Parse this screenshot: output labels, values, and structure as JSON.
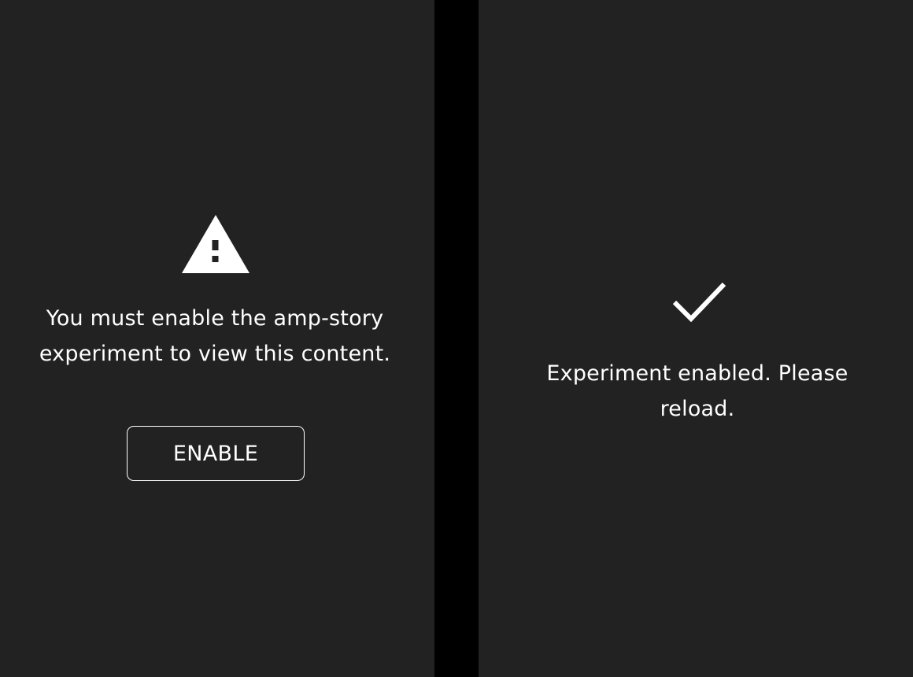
{
  "colors": {
    "page_background": "#000000",
    "panel_background": "#222222",
    "foreground": "#ffffff"
  },
  "left_panel": {
    "icon": "warning-triangle-icon",
    "message": "You must enable the amp-story experiment to view this content.",
    "button_label": "ENABLE"
  },
  "right_panel": {
    "icon": "checkmark-icon",
    "message": "Experiment enabled. Please reload."
  }
}
